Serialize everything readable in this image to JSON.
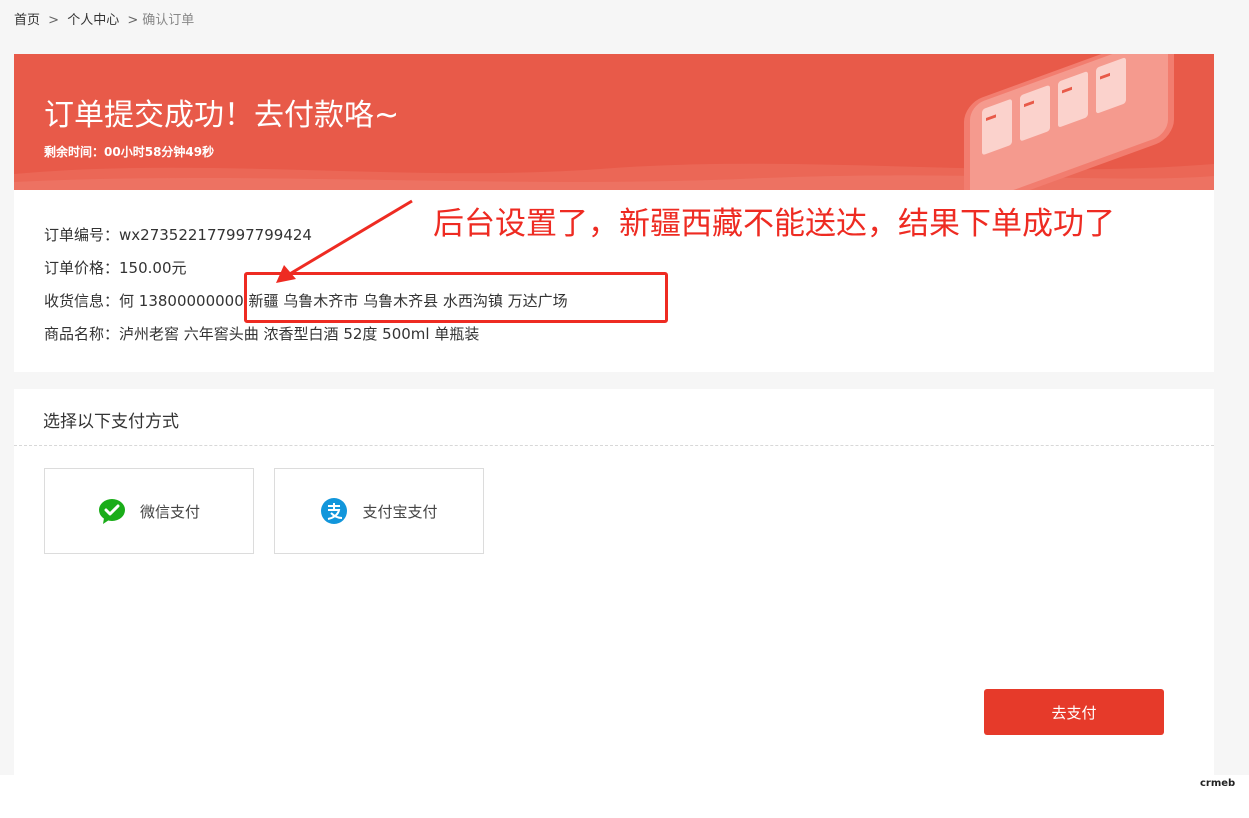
{
  "breadcrumb": {
    "home": "首页",
    "separator": ">",
    "user_center": "个人中心",
    "current": "确认订单"
  },
  "banner": {
    "title": "订单提交成功！去付款咯~",
    "timer_label": "剩余时间：",
    "timer_value": "00小时58分钟49秒",
    "background_color": "#e85a49"
  },
  "order": {
    "number_label": "订单编号：",
    "number_value": "wx273522177997799424",
    "price_label": "订单价格：",
    "price_value": "150.00元",
    "shipping_label": "收货信息：",
    "shipping_value": "何 13800000000 新疆 乌鲁木齐市 乌鲁木齐县 水西沟镇 万达广场",
    "product_label": "商品名称：",
    "product_value": "泸州老窖 六年窖头曲 浓香型白酒 52度 500ml 单瓶装"
  },
  "annotation": {
    "text": "后台设置了，新疆西藏不能送达，结果下单成功了",
    "color": "#ee2b22"
  },
  "payment": {
    "title": "选择以下支付方式",
    "options": [
      {
        "label": "微信支付",
        "icon": "wechat-icon",
        "color": "#1aad19"
      },
      {
        "label": "支付宝支付",
        "icon": "alipay-icon",
        "color": "#1296db"
      }
    ],
    "submit_label": "去支付",
    "submit_color": "#e63a2a"
  },
  "watermark": "crmeb"
}
